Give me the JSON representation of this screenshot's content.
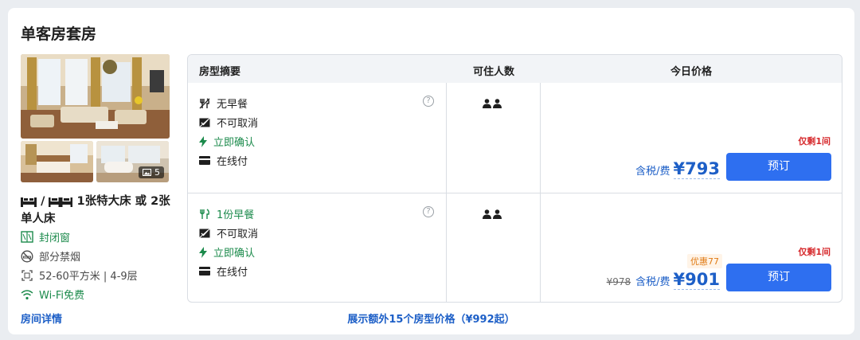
{
  "room": {
    "title": "单客房套房",
    "photo_count": "5",
    "bed_separator": "/",
    "bed_text": "1张特大床 或 2张单人床",
    "amenities": [
      {
        "icon": "window-icon",
        "label": "封闭窗",
        "color": "#1b8a4b"
      },
      {
        "icon": "no-smoking-icon",
        "label": "部分禁烟",
        "color": "#4a4a4a"
      },
      {
        "icon": "area-icon",
        "label": "52-60平方米 | 4-9层",
        "color": "#4a4a4a"
      },
      {
        "icon": "wifi-icon",
        "label": "Wi-Fi免费",
        "color": "#1b8a4b"
      }
    ],
    "detail_link": "房间详情"
  },
  "table": {
    "headers": [
      "房型摘要",
      "可住人数",
      "今日价格"
    ],
    "rows": [
      {
        "features": [
          {
            "icon": "no-meal-icon",
            "label": "无早餐"
          },
          {
            "icon": "no-cancel-icon",
            "label": "不可取消"
          },
          {
            "icon": "lightning-icon",
            "label": "立即确认"
          },
          {
            "icon": "card-icon",
            "label": "在线付"
          }
        ],
        "help": "?",
        "guests": 2,
        "remaining": "仅剩1间",
        "tax_label": "含税/费",
        "price": "¥793",
        "button": "预订"
      },
      {
        "features": [
          {
            "icon": "meal-icon",
            "label": "1份早餐"
          },
          {
            "icon": "no-cancel-icon",
            "label": "不可取消"
          },
          {
            "icon": "lightning-icon",
            "label": "立即确认"
          },
          {
            "icon": "card-icon",
            "label": "在线付"
          }
        ],
        "help": "?",
        "guests": 2,
        "remaining": "仅剩1间",
        "discount": "优惠77",
        "original_price": "¥978",
        "tax_label": "含税/费",
        "price": "¥901",
        "button": "预订"
      }
    ]
  },
  "more_link": "展示额外15个房型价格（¥992起）",
  "colors": {
    "accent": "#2e6ff0",
    "price": "#1d5fc7",
    "green": "#1b8a4b",
    "alert": "#d6282b"
  }
}
